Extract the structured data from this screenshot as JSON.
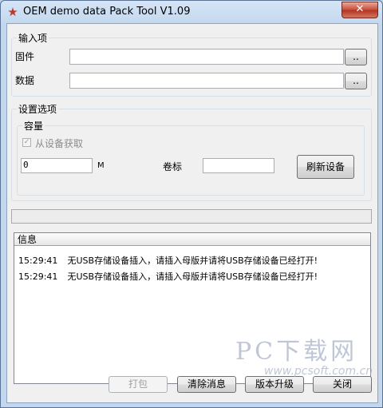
{
  "window": {
    "title": "OEM demo data Pack Tool V1.09",
    "close_label": "✕"
  },
  "input_group": {
    "legend": "输入项",
    "firmware_label": "固件",
    "firmware_value": "",
    "firmware_browse": "..",
    "data_label": "数据",
    "data_value": "",
    "data_browse": ".."
  },
  "settings_group": {
    "legend": "设置选项",
    "capacity_legend": "容量",
    "from_device_label": "从设备获取",
    "capacity_value": "0",
    "capacity_unit": "M",
    "volume_label": "卷标",
    "volume_value": "",
    "refresh_button": "刷新设备"
  },
  "info": {
    "header": "信息",
    "logs": [
      {
        "time": "15:29:41",
        "message": "无USB存储设备插入，请插入母版并请将USB存储设备已经打开!"
      },
      {
        "time": "15:29:41",
        "message": "无USB存储设备插入，请插入母版并请将USB存储设备已经打开!"
      }
    ]
  },
  "footer": {
    "pack_button": "打包",
    "clear_button": "清除消息",
    "upgrade_button": "版本升级",
    "close_button": "关闭"
  },
  "watermark": {
    "text": "PC下载网",
    "url": "www.pcsoft.com.cn"
  }
}
